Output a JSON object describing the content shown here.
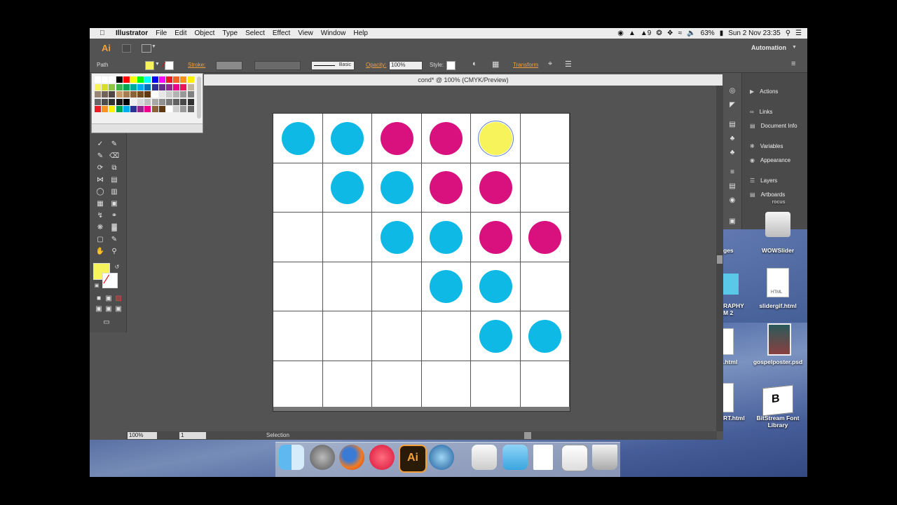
{
  "menubar": {
    "apple": "",
    "app_name": "Illustrator",
    "items": [
      "File",
      "Edit",
      "Object",
      "Type",
      "Select",
      "Effect",
      "View",
      "Window",
      "Help"
    ],
    "status_num": "9",
    "battery": "63%",
    "datetime": "Sun 2 Nov  23:35"
  },
  "appbar": {
    "logo": "Ai",
    "workspace": "Automation"
  },
  "control_bar": {
    "selection_type": "Path",
    "stroke_label": "Stroke:",
    "brush_label": "Basic",
    "opacity_label": "Opacity:",
    "opacity_value": "100%",
    "style_label": "Style:",
    "transform_label": "Transform"
  },
  "document": {
    "tab_title": "cond* @ 100% (CMYK/Preview)",
    "zoom": "100%",
    "artboard_num": "1",
    "tool_status": "Selection"
  },
  "colors": {
    "cyan": "#0fb9e5",
    "magenta": "#d8117f",
    "yellow": "#f7f35a"
  },
  "grid": {
    "rows": 6,
    "cols": 6,
    "dots": [
      [
        0,
        0,
        "cyan"
      ],
      [
        0,
        1,
        "cyan"
      ],
      [
        0,
        2,
        "magenta"
      ],
      [
        0,
        3,
        "magenta"
      ],
      [
        0,
        4,
        "yellow"
      ],
      [
        1,
        1,
        "cyan"
      ],
      [
        1,
        2,
        "cyan"
      ],
      [
        1,
        3,
        "magenta"
      ],
      [
        1,
        4,
        "magenta"
      ],
      [
        2,
        2,
        "cyan"
      ],
      [
        2,
        3,
        "cyan"
      ],
      [
        2,
        4,
        "magenta"
      ],
      [
        2,
        5,
        "magenta"
      ],
      [
        3,
        3,
        "cyan"
      ],
      [
        3,
        4,
        "cyan"
      ],
      [
        4,
        4,
        "cyan"
      ],
      [
        4,
        5,
        "cyan"
      ]
    ]
  },
  "panels": [
    "Actions",
    "Links",
    "Document Info",
    "Variables",
    "Appearance",
    "Layers",
    "Artboards"
  ],
  "desktop_icons": {
    "wowslider": "WOWSlider",
    "slidergif": "slidergif.html",
    "gospelposter": "gospelposter.psd",
    "bitstream": "BitStream Font Library",
    "partial_ges": "ges",
    "partial_graphy": "RAPHY\nM 2",
    "partial_html": ".html",
    "partial_rt": "RT.html",
    "partial_top": "rocus",
    "html_badge": "HTML"
  }
}
